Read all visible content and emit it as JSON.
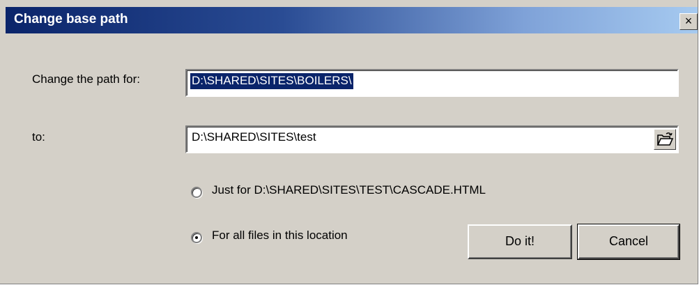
{
  "dialog": {
    "title": "Change base path",
    "close_glyph": "×"
  },
  "from": {
    "label": "Change the path for:",
    "value": "D:\\SHARED\\SITES\\BOILERS\\"
  },
  "to": {
    "label": "to:",
    "value": "D:\\SHARED\\SITES\\test",
    "browse_icon": "open-folder-icon"
  },
  "scope": {
    "options": [
      {
        "label": "Just for D:\\SHARED\\SITES\\TEST\\CASCADE.HTML",
        "selected": false
      },
      {
        "label": "For all files in this location",
        "selected": true
      }
    ]
  },
  "buttons": {
    "ok_label": "Do it!",
    "cancel_label": "Cancel"
  },
  "colors": {
    "titlebar_start": "#0a246a",
    "titlebar_end": "#a6caf0",
    "face": "#d4d0c8",
    "selection": "#0a246a"
  }
}
